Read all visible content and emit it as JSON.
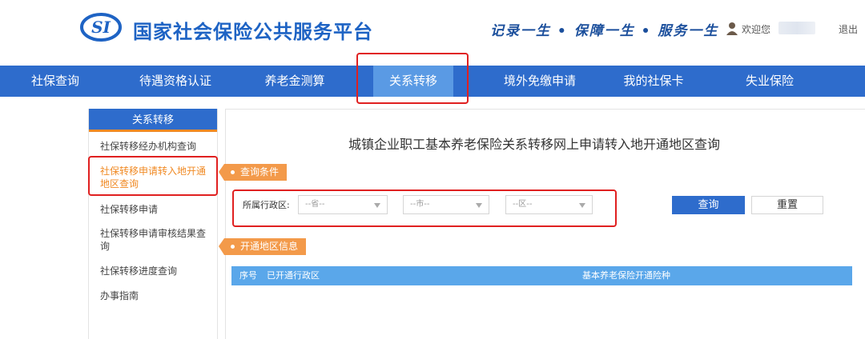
{
  "header": {
    "site_title": "国家社会保险公共服务平台",
    "slogan": "记录一生 • 保障一生 • 服务一生",
    "welcome": "欢迎您",
    "logout": "退出",
    "logo_text": "SI"
  },
  "nav": {
    "items": [
      {
        "label": "社保查询"
      },
      {
        "label": "待遇资格认证"
      },
      {
        "label": "养老金测算"
      },
      {
        "label": "关系转移"
      },
      {
        "label": "境外免缴申请"
      },
      {
        "label": "我的社保卡"
      },
      {
        "label": "失业保险"
      }
    ],
    "active_index": 3
  },
  "sidebar": {
    "title": "关系转移",
    "items": [
      {
        "label": "社保转移经办机构查询"
      },
      {
        "label": "社保转移申请转入地开通地区查询"
      },
      {
        "label": "社保转移申请"
      },
      {
        "label": "社保转移申请审核结果查询"
      },
      {
        "label": "社保转移进度查询"
      },
      {
        "label": "办事指南"
      }
    ],
    "active_index": 1
  },
  "main": {
    "title": "城镇企业职工基本养老保险关系转移网上申请转入地开通地区查询",
    "query_section": "查询条件",
    "region_label": "所属行政区:",
    "selects": {
      "province": "--省--",
      "city": "--市--",
      "district": "--区--"
    },
    "query_button": "查询",
    "reset_button": "重置",
    "result_section": "开通地区信息",
    "table_headers": [
      "序号",
      "已开通行政区",
      "基本养老保险开通险种"
    ]
  },
  "colors": {
    "primary": "#2e6ccc",
    "nav_active": "#5a9ae4",
    "accent_orange": "#f39a4a",
    "highlight_red": "#e02020",
    "table_header": "#5aa7ea"
  }
}
